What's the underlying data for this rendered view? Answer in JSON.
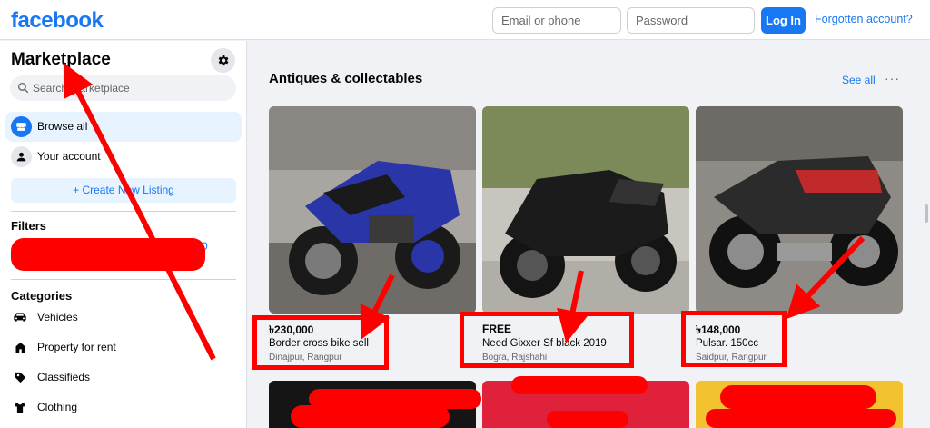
{
  "header": {
    "logo": "facebook",
    "email_placeholder": "Email or phone",
    "password_placeholder": "Password",
    "login_label": "Log In",
    "forgot_label": "Forgotten account?"
  },
  "sidebar": {
    "title": "Marketplace",
    "search_placeholder": "Search Marketplace",
    "nav": [
      {
        "label": "Browse all",
        "icon": "storefront-icon"
      },
      {
        "label": "Your account",
        "icon": "person-icon"
      }
    ],
    "create_label": "+ Create New Listing",
    "filters_title": "Filters",
    "filters_visible_text": "0",
    "categories_title": "Categories",
    "categories": [
      {
        "label": "Vehicles",
        "icon": "car-icon"
      },
      {
        "label": "Property for rent",
        "icon": "house-icon"
      },
      {
        "label": "Classifieds",
        "icon": "tag-icon"
      },
      {
        "label": "Clothing",
        "icon": "shirt-icon"
      }
    ]
  },
  "main": {
    "section_title": "Antiques & collectables",
    "see_all": "See all",
    "more": "···",
    "listings": [
      {
        "price": "৳230,000",
        "title": "Border cross bike sell",
        "location": "Dinajpur, Rangpur"
      },
      {
        "price": "FREE",
        "title": "Need Gixxer Sf black 2019",
        "location": "Bogra, Rajshahi"
      },
      {
        "price": "৳148,000",
        "title": "Pulsar. 150cc",
        "location": "Saidpur, Rangpur"
      }
    ]
  },
  "colors": {
    "brand": "#1877f2",
    "annotation": "#ff0000",
    "bike1": "#2a35a8",
    "bike2": "#1b1b1b",
    "bike3": "#2b2b2b"
  }
}
